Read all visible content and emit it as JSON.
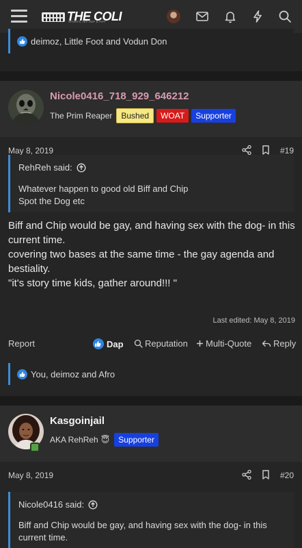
{
  "header": {
    "logo_text": "THE COLI",
    "logo_sub": "SPORTS, HIP HOP & PIFF"
  },
  "prev_post": {
    "reactions_text": "deimoz, Little Foot and Vodun Don"
  },
  "post1": {
    "username": "Nicole0416_718_929_646212",
    "username_color": "#d69bb0",
    "user_title": "The Prim Reaper",
    "banners": [
      "Bushed",
      "WOAT",
      "Supporter"
    ],
    "date": "May 8, 2019",
    "number": "#19",
    "quote_author": "RehReh said:",
    "quote_lines": [
      "Whatever happen to good old Biff and Chip",
      "Spot the Dog etc"
    ],
    "message_lines": [
      "Biff and Chip would be gay, and having sex with the dog- in this current time.",
      "covering two bases at the same time - the gay agenda and bestiality.",
      "\"it's story time kids, gather around!!! \""
    ],
    "last_edited": "Last edited: May 8, 2019",
    "actions": {
      "report": "Report",
      "dap": "Dap",
      "reputation": "Reputation",
      "multiquote": "Multi-Quote",
      "reply": "Reply"
    },
    "reactions_text": "You, deimoz and Afro"
  },
  "post2": {
    "username": "Kasgoinjail",
    "user_title": "AKA RehReh",
    "emoji": "😇",
    "banners": [
      "Supporter"
    ],
    "date": "May 8, 2019",
    "number": "#20",
    "quote_author": "Nicole0416 said:",
    "quote_lines": [
      "Biff and Chip would be gay, and having sex with the dog- in this",
      "current time."
    ]
  },
  "colors": {
    "accent": "#3a8ed8",
    "like": "#2f86e0",
    "woat": "#d81a1a",
    "supporter": "#1740e0",
    "bushed": "#f7e884"
  }
}
